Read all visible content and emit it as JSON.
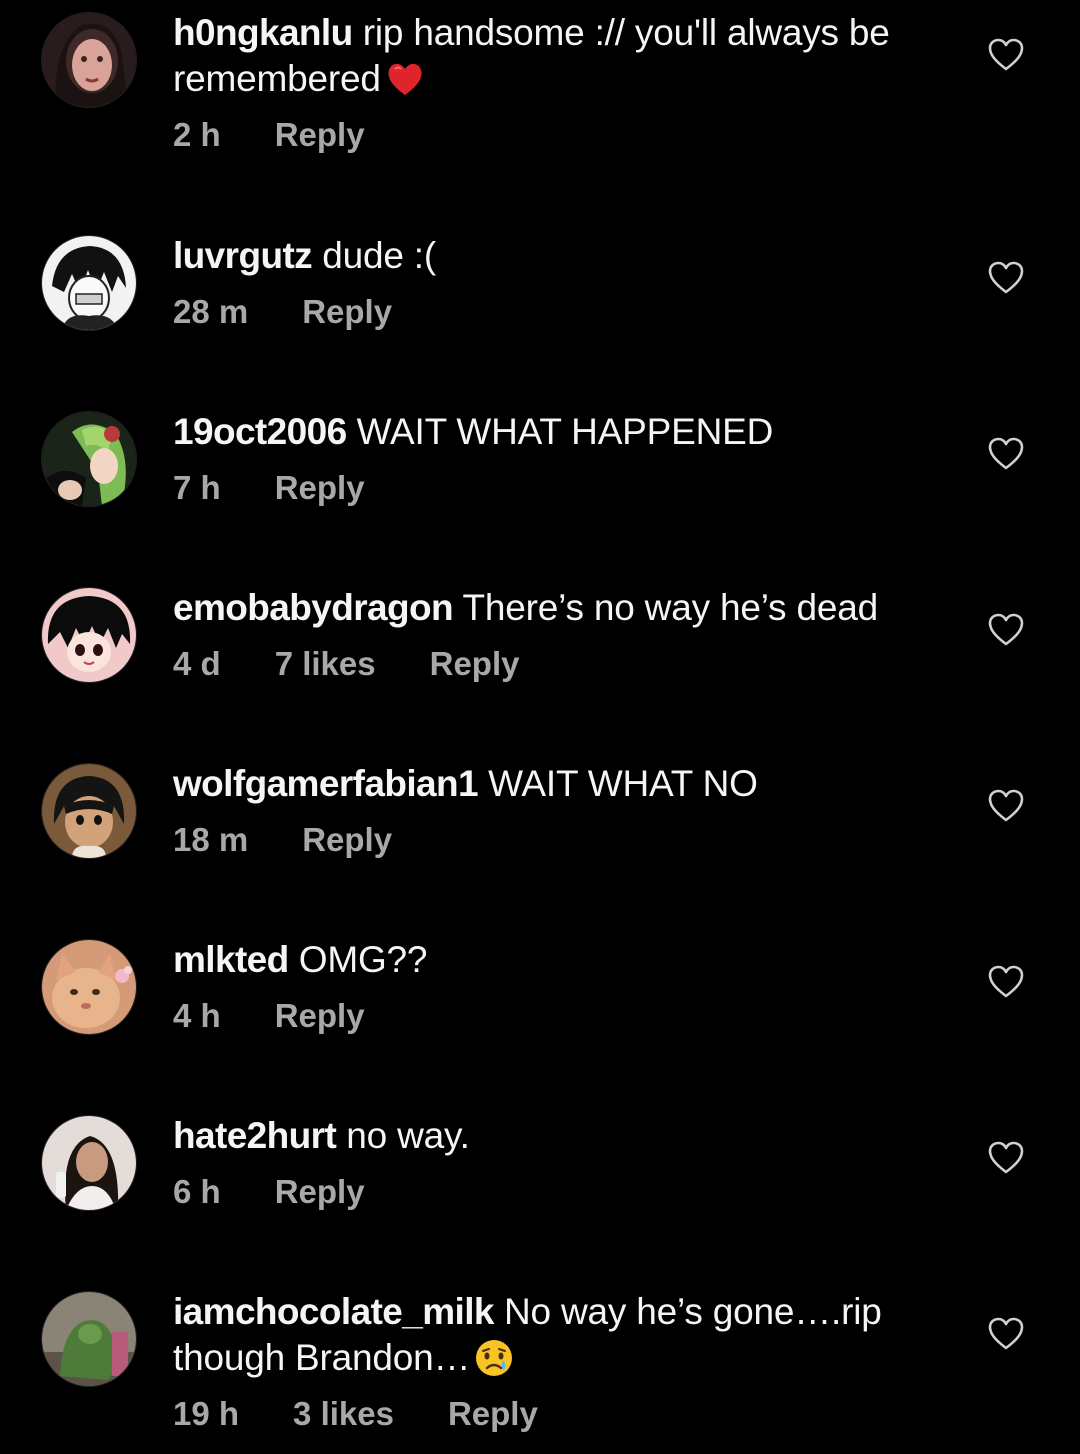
{
  "comments": [
    {
      "username": "h0ngkanlu",
      "text": "rip handsome :// you'll always be remembered",
      "emoji": "red-heart",
      "time": "2 h",
      "likes": "",
      "reply": "Reply",
      "avatar_color": "#5a3b3a"
    },
    {
      "username": "luvrgutz",
      "text": "dude :(",
      "emoji": "",
      "time": "28 m",
      "likes": "",
      "reply": "Reply",
      "avatar_color": "#e8e8e8"
    },
    {
      "username": "19oct2006",
      "text": "WAIT WHAT HAPPENED",
      "emoji": "",
      "time": "7 h",
      "likes": "",
      "reply": "Reply",
      "avatar_color": "#6fa84a"
    },
    {
      "username": "emobabydragon",
      "text": "There’s no way he’s dead",
      "emoji": "",
      "time": "4 d",
      "likes": "7 likes",
      "reply": "Reply",
      "avatar_color": "#f0c8c8"
    },
    {
      "username": "wolfgamerfabian1",
      "text": "WAIT WHAT NO",
      "emoji": "",
      "time": "18 m",
      "likes": "",
      "reply": "Reply",
      "avatar_color": "#8a6a4a"
    },
    {
      "username": "mlkted",
      "text": "OMG??",
      "emoji": "",
      "time": "4 h",
      "likes": "",
      "reply": "Reply",
      "avatar_color": "#e0a57a"
    },
    {
      "username": "hate2hurt",
      "text": "no way.",
      "emoji": "",
      "time": "6 h",
      "likes": "",
      "reply": "Reply",
      "avatar_color": "#d9d0cc"
    },
    {
      "username": "iamchocolate_milk",
      "text": "No way he’s gone….rip though Brandon…",
      "emoji": "crying-face",
      "time": "19 h",
      "likes": "3 likes",
      "reply": "Reply",
      "avatar_color": "#6f6a5a"
    }
  ],
  "colors": {
    "background": "#000000",
    "text": "#f5f5f5",
    "meta": "#a8a8a8",
    "heart_emoji": "#e0242c",
    "crying_emoji": "#f7c325"
  },
  "icons": {
    "like": "heart-outline-icon"
  }
}
